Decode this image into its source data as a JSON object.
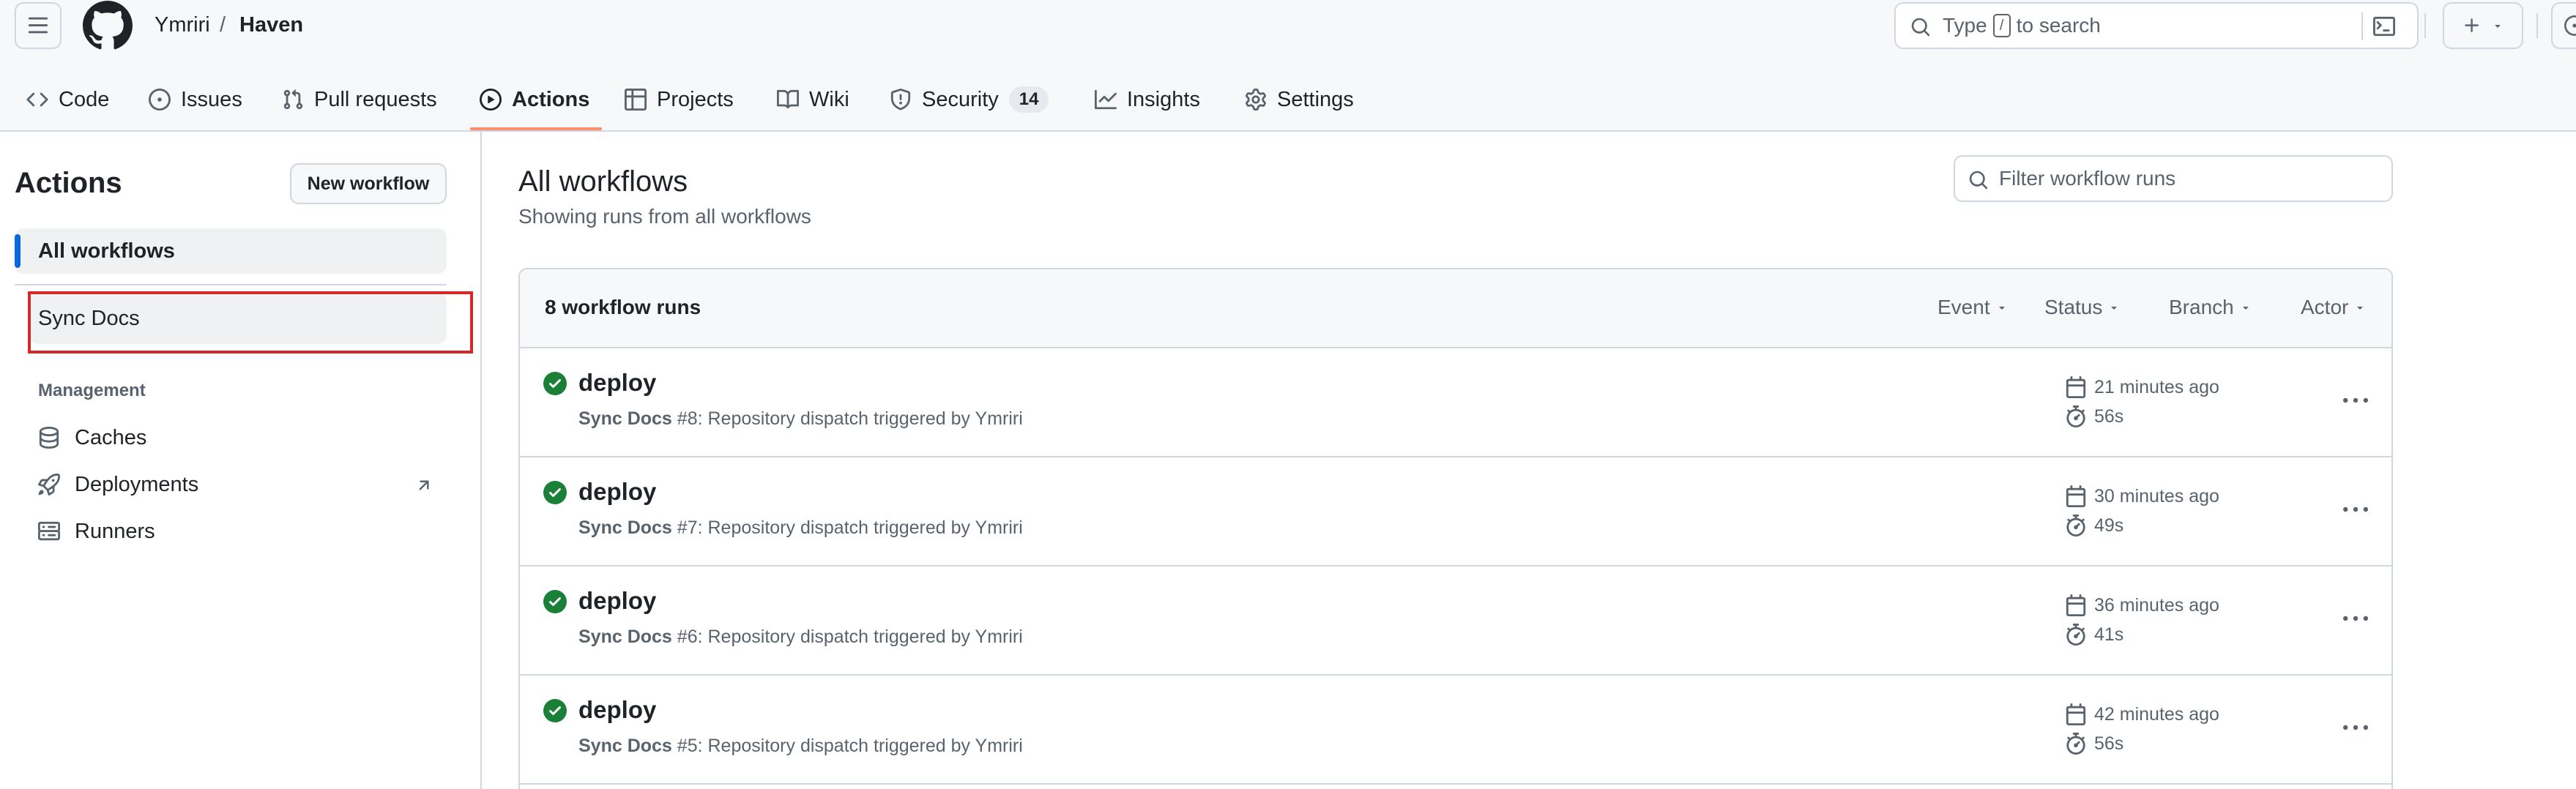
{
  "header": {
    "owner": "Ymriri",
    "separator": "/",
    "repo": "Haven",
    "search_prefix": "Type",
    "search_key": "/",
    "search_suffix": "to search"
  },
  "nav": {
    "code": "Code",
    "issues": "Issues",
    "pull_requests": "Pull requests",
    "actions": "Actions",
    "projects": "Projects",
    "wiki": "Wiki",
    "security": "Security",
    "security_count": "14",
    "insights": "Insights",
    "settings": "Settings"
  },
  "sidebar": {
    "title": "Actions",
    "new_workflow": "New workflow",
    "all_workflows": "All workflows",
    "sync_docs": "Sync Docs",
    "management_label": "Management",
    "caches": "Caches",
    "deployments": "Deployments",
    "runners": "Runners"
  },
  "main": {
    "title": "All workflows",
    "subtitle": "Showing runs from all workflows",
    "filter_placeholder": "Filter workflow runs",
    "runs_count": "8 workflow runs",
    "filters": {
      "event": "Event",
      "status": "Status",
      "branch": "Branch",
      "actor": "Actor"
    },
    "runs": [
      {
        "title": "deploy",
        "workflow": "Sync Docs",
        "number": "#8",
        "desc": ": Repository dispatch triggered by Ymriri",
        "time": "21 minutes ago",
        "duration": "56s"
      },
      {
        "title": "deploy",
        "workflow": "Sync Docs",
        "number": "#7",
        "desc": ": Repository dispatch triggered by Ymriri",
        "time": "30 minutes ago",
        "duration": "49s"
      },
      {
        "title": "deploy",
        "workflow": "Sync Docs",
        "number": "#6",
        "desc": ": Repository dispatch triggered by Ymriri",
        "time": "36 minutes ago",
        "duration": "41s"
      },
      {
        "title": "deploy",
        "workflow": "Sync Docs",
        "number": "#5",
        "desc": ": Repository dispatch triggered by Ymriri",
        "time": "42 minutes ago",
        "duration": "56s"
      }
    ]
  },
  "colors": {
    "accent_blue": "#0969da",
    "success_green": "#1a7f37",
    "active_tab": "#fd8c73",
    "highlight_red": "#d62828"
  }
}
